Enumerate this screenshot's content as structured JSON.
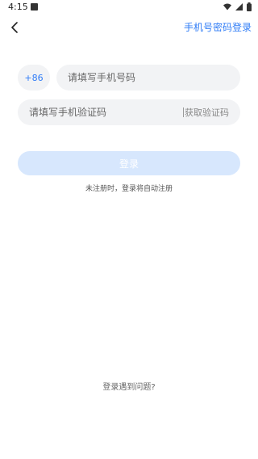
{
  "status_bar": {
    "time": "4:15",
    "notification_icon": "app-notification-icon",
    "wifi_icon": "wifi-icon",
    "signal_icon": "cell-signal-icon",
    "battery_icon": "battery-icon"
  },
  "nav": {
    "back_icon": "chevron-left-icon",
    "password_login_label": "手机号密码登录"
  },
  "form": {
    "country_code": "+86",
    "phone": {
      "value": "",
      "placeholder": "请填写手机号码"
    },
    "code": {
      "value": "",
      "placeholder": "请填写手机验证码"
    },
    "get_code_label": "获取验证码",
    "login_label": "登录",
    "auto_register_hint": "未注册时，登录将自动注册"
  },
  "footer": {
    "help_label": "登录遇到问题?"
  },
  "colors": {
    "accent": "#2f7cf6",
    "field_bg": "#f2f3f5",
    "button_disabled": "#d7e7fd"
  }
}
